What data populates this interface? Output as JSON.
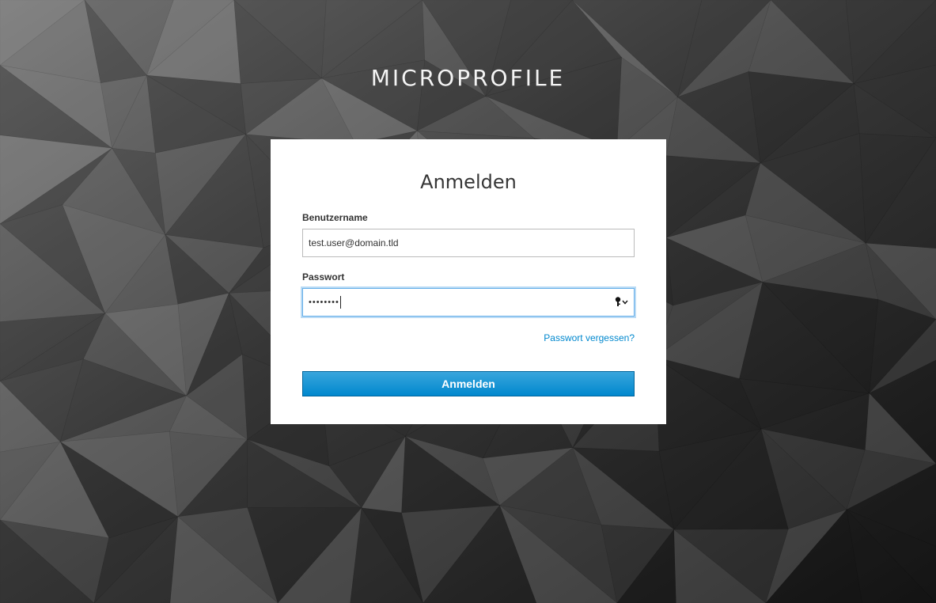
{
  "brand": {
    "title": "MICROPROFILE"
  },
  "login": {
    "heading": "Anmelden",
    "username": {
      "label": "Benutzername",
      "value": "test.user@domain.tld"
    },
    "password": {
      "label": "Passwort",
      "masked_value": "••••••••",
      "manager_icon": "key-icon"
    },
    "forgot_link": "Passwort vergessen?",
    "submit_label": "Anmelden"
  },
  "colors": {
    "accent": "#0088ce",
    "focus": "#66afe9",
    "card": "#ffffff"
  }
}
